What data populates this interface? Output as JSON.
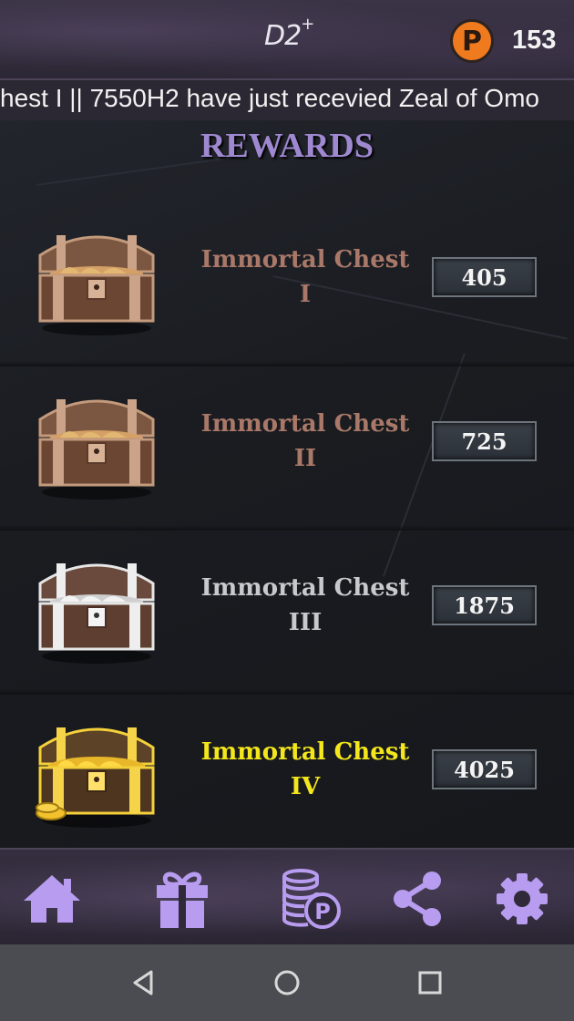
{
  "header": {
    "logo_main": "D2",
    "logo_sup": "+",
    "coin_letter": "P",
    "balance": "153"
  },
  "ticker": {
    "text": "hest I || 7550H2 have just recevied Zeal of Omo"
  },
  "page_title": "REWARDS",
  "rewards": [
    {
      "name": "Immortal Chest",
      "tier": "I",
      "price": "405",
      "name_color": "#a97868",
      "chest_icon": "bronze-chest-icon"
    },
    {
      "name": "Immortal Chest",
      "tier": "II",
      "price": "725",
      "name_color": "#a97868",
      "chest_icon": "bronze-chest-icon"
    },
    {
      "name": "Immortal Chest",
      "tier": "III",
      "price": "1875",
      "name_color": "#c7c9cc",
      "chest_icon": "silver-chest-icon"
    },
    {
      "name": "Immortal Chest",
      "tier": "IV",
      "price": "4025",
      "name_color": "#f3e61c",
      "chest_icon": "gold-chest-icon"
    }
  ],
  "bottom_nav": {
    "items": [
      {
        "icon": "home-icon"
      },
      {
        "icon": "gift-icon"
      },
      {
        "icon": "coins-p-icon"
      },
      {
        "icon": "share-icon"
      },
      {
        "icon": "gear-icon"
      }
    ],
    "icon_color": "#b79cf0"
  },
  "colors": {
    "title": "#9e88d0",
    "coin": "#f07a1e"
  }
}
